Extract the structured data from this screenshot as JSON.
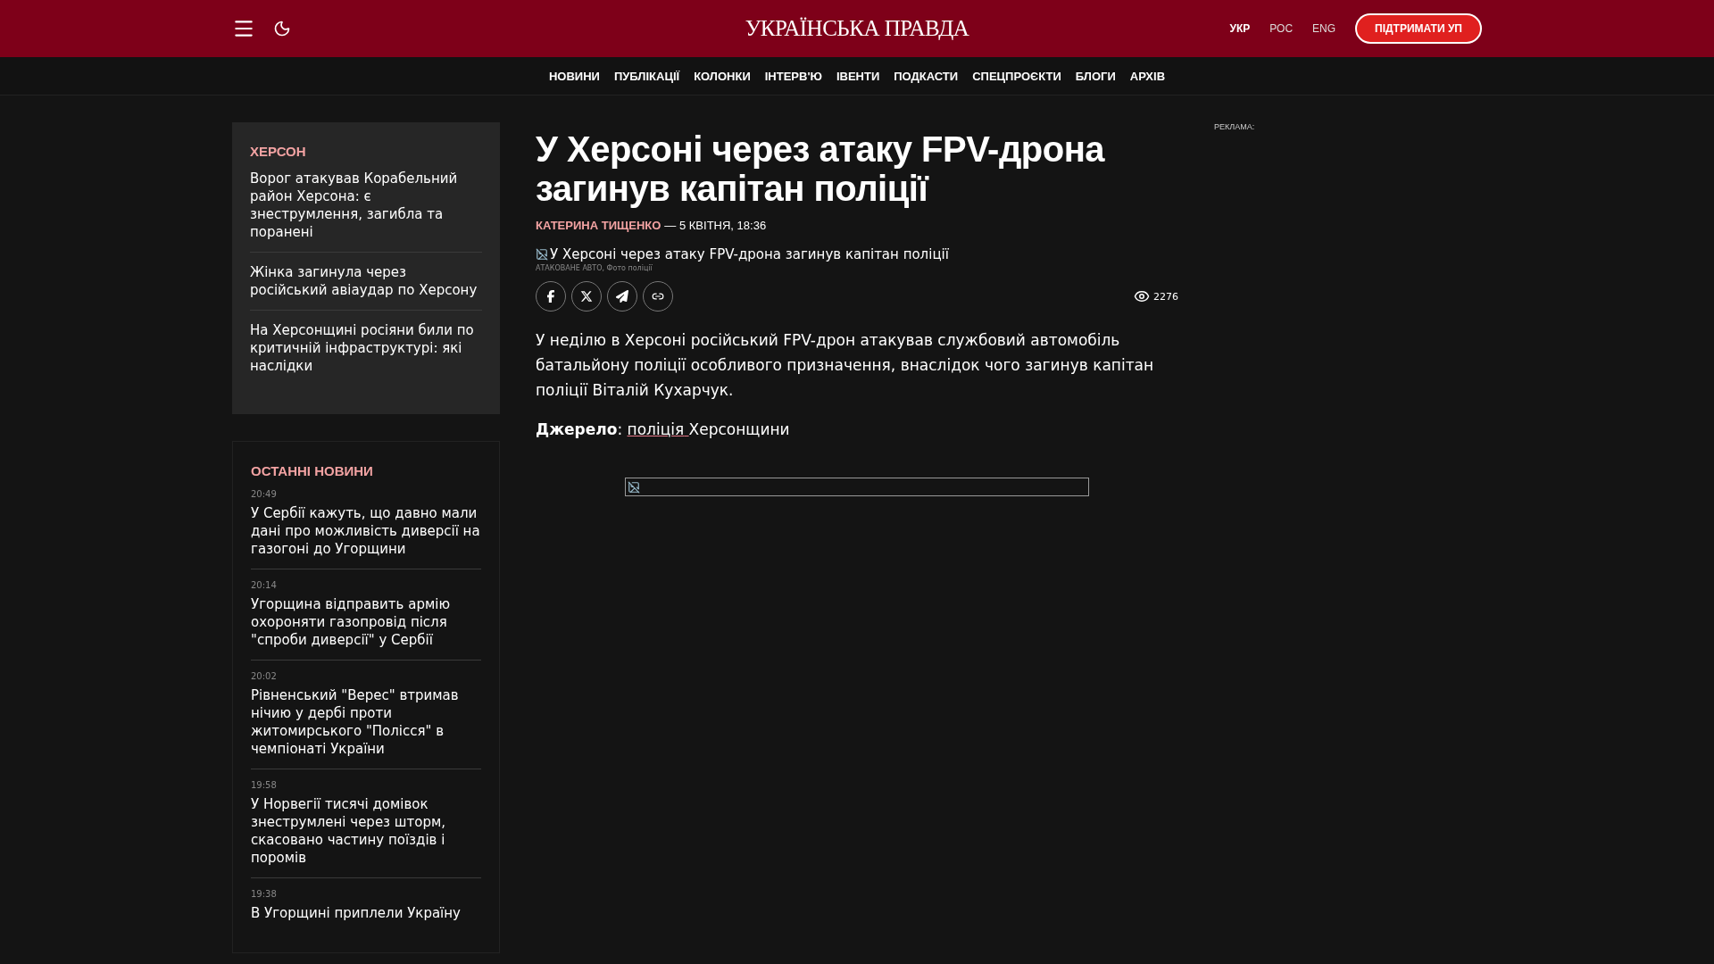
{
  "header": {
    "logo": "УКРАЇНСЬКА ПРАВДА",
    "languages": [
      {
        "label": "УКР",
        "selected": true
      },
      {
        "label": "РОС",
        "selected": false
      },
      {
        "label": "ENG",
        "selected": false
      }
    ],
    "support_button": "ПІДТРИМАТИ УП"
  },
  "nav": [
    "НОВИНИ",
    "ПУБЛІКАЦІЇ",
    "КОЛОНКИ",
    "ІНТЕРВ'Ю",
    "ІВЕНТИ",
    "ПОДКАСТИ",
    "СПЕЦПРОЄКТИ",
    "БЛОГИ",
    "АРХІВ"
  ],
  "region_block": {
    "title": "ХЕРСОН",
    "items": [
      "Ворог атакував Корабельний район Херсона: є знеструмлення, загибла та поранені",
      "Жінка загинула через російський авіаудар по Херсону",
      "На Херсонщині росіяни били по критичній інфраструктурі: які наслідки"
    ]
  },
  "latest_news": {
    "title": "ОСТАННІ НОВИНИ",
    "items": [
      {
        "time": "20:49",
        "title": "У Сербії кажуть, що давно мали дані про можливість диверсії на газогоні до Угорщини"
      },
      {
        "time": "20:14",
        "title": "Угорщина відправить армію охороняти газопровід після \"спроби диверсії\" у Сербії"
      },
      {
        "time": "20:02",
        "title": "Рівненський \"Верес\" втримав нічию у дербі проти житомирського \"Полісся\" в чемпіонаті України"
      },
      {
        "time": "19:58",
        "title": "У Норвегії тисячі домівок знеструмлені через шторм, скасовано частину поїздів і поромів"
      },
      {
        "time": "19:38",
        "title": "В Угорщині приплели Україну"
      }
    ]
  },
  "article": {
    "title": "У Херсоні через атаку FPV-дрона загинув капітан поліції",
    "author": "КАТЕРИНА ТИЩЕНКО",
    "date": "— 5 КВІТНЯ, 18:36",
    "image_alt": "У Херсоні через атаку FPV-дрона загинув капітан поліції",
    "caption": "АТАКОВАНЕ АВТО, Фото поліції",
    "views": "2276",
    "body": "У неділю в Херсоні російський FPV-дрон атакував службовий автомобіль батальйону поліції особливого призначення, внаслідок чого загинув капітан поліції Віталій Кухарчук.",
    "source": {
      "label": "Джерело",
      "separator": ":",
      "link": "поліція",
      "rest": "Херсонщини"
    }
  },
  "ad_label": "РЕКЛАМА:"
}
